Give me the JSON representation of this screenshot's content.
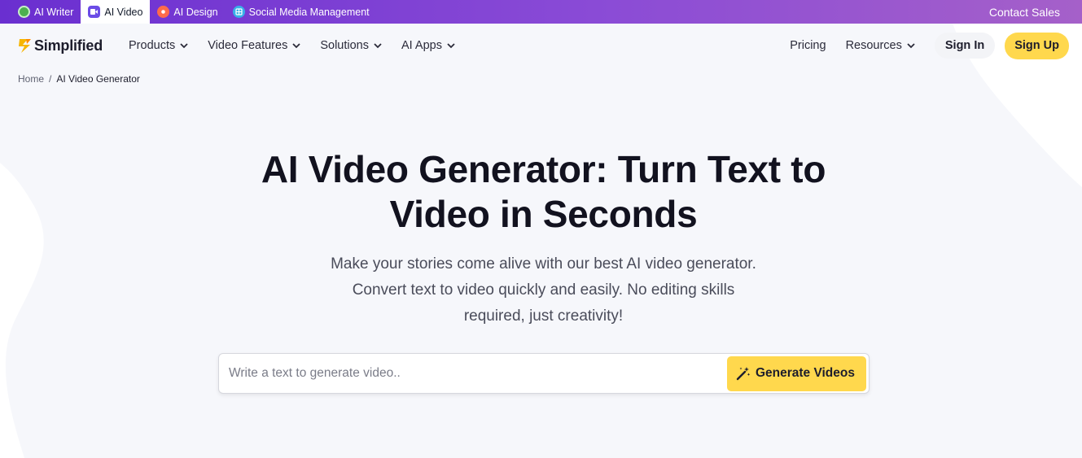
{
  "topbar": {
    "products": [
      {
        "label": "AI Writer",
        "icon": "ai-writer-icon",
        "active": false
      },
      {
        "label": "AI Video",
        "icon": "ai-video-icon",
        "active": true
      },
      {
        "label": "AI Design",
        "icon": "ai-design-icon",
        "active": false
      },
      {
        "label": "Social Media Management",
        "icon": "social-media-icon",
        "active": false
      }
    ],
    "contact_label": "Contact Sales",
    "gradient_colors": [
      "#6a2fd0",
      "#a560c9"
    ]
  },
  "nav": {
    "logo_text": "Simplified",
    "menu": [
      {
        "label": "Products"
      },
      {
        "label": "Video Features"
      },
      {
        "label": "Solutions"
      },
      {
        "label": "AI Apps"
      }
    ],
    "pricing_label": "Pricing",
    "resources_label": "Resources",
    "signin_label": "Sign In",
    "signup_label": "Sign Up",
    "accent_color": "#ffd84d"
  },
  "breadcrumb": {
    "home": "Home",
    "separator": "/",
    "current": "AI Video Generator"
  },
  "hero": {
    "title_line1": "AI Video Generator: Turn Text to",
    "title_line2": "Video in Seconds",
    "subtitle_line1": "Make your stories come alive with our best AI video generator.",
    "subtitle_line2": "Convert text to video quickly and easily. No editing skills",
    "subtitle_line3": "required, just creativity!",
    "input_placeholder": "Write a text to generate video..",
    "input_value": "",
    "button_label": "Generate Videos",
    "button_icon": "magic-wand-icon"
  }
}
